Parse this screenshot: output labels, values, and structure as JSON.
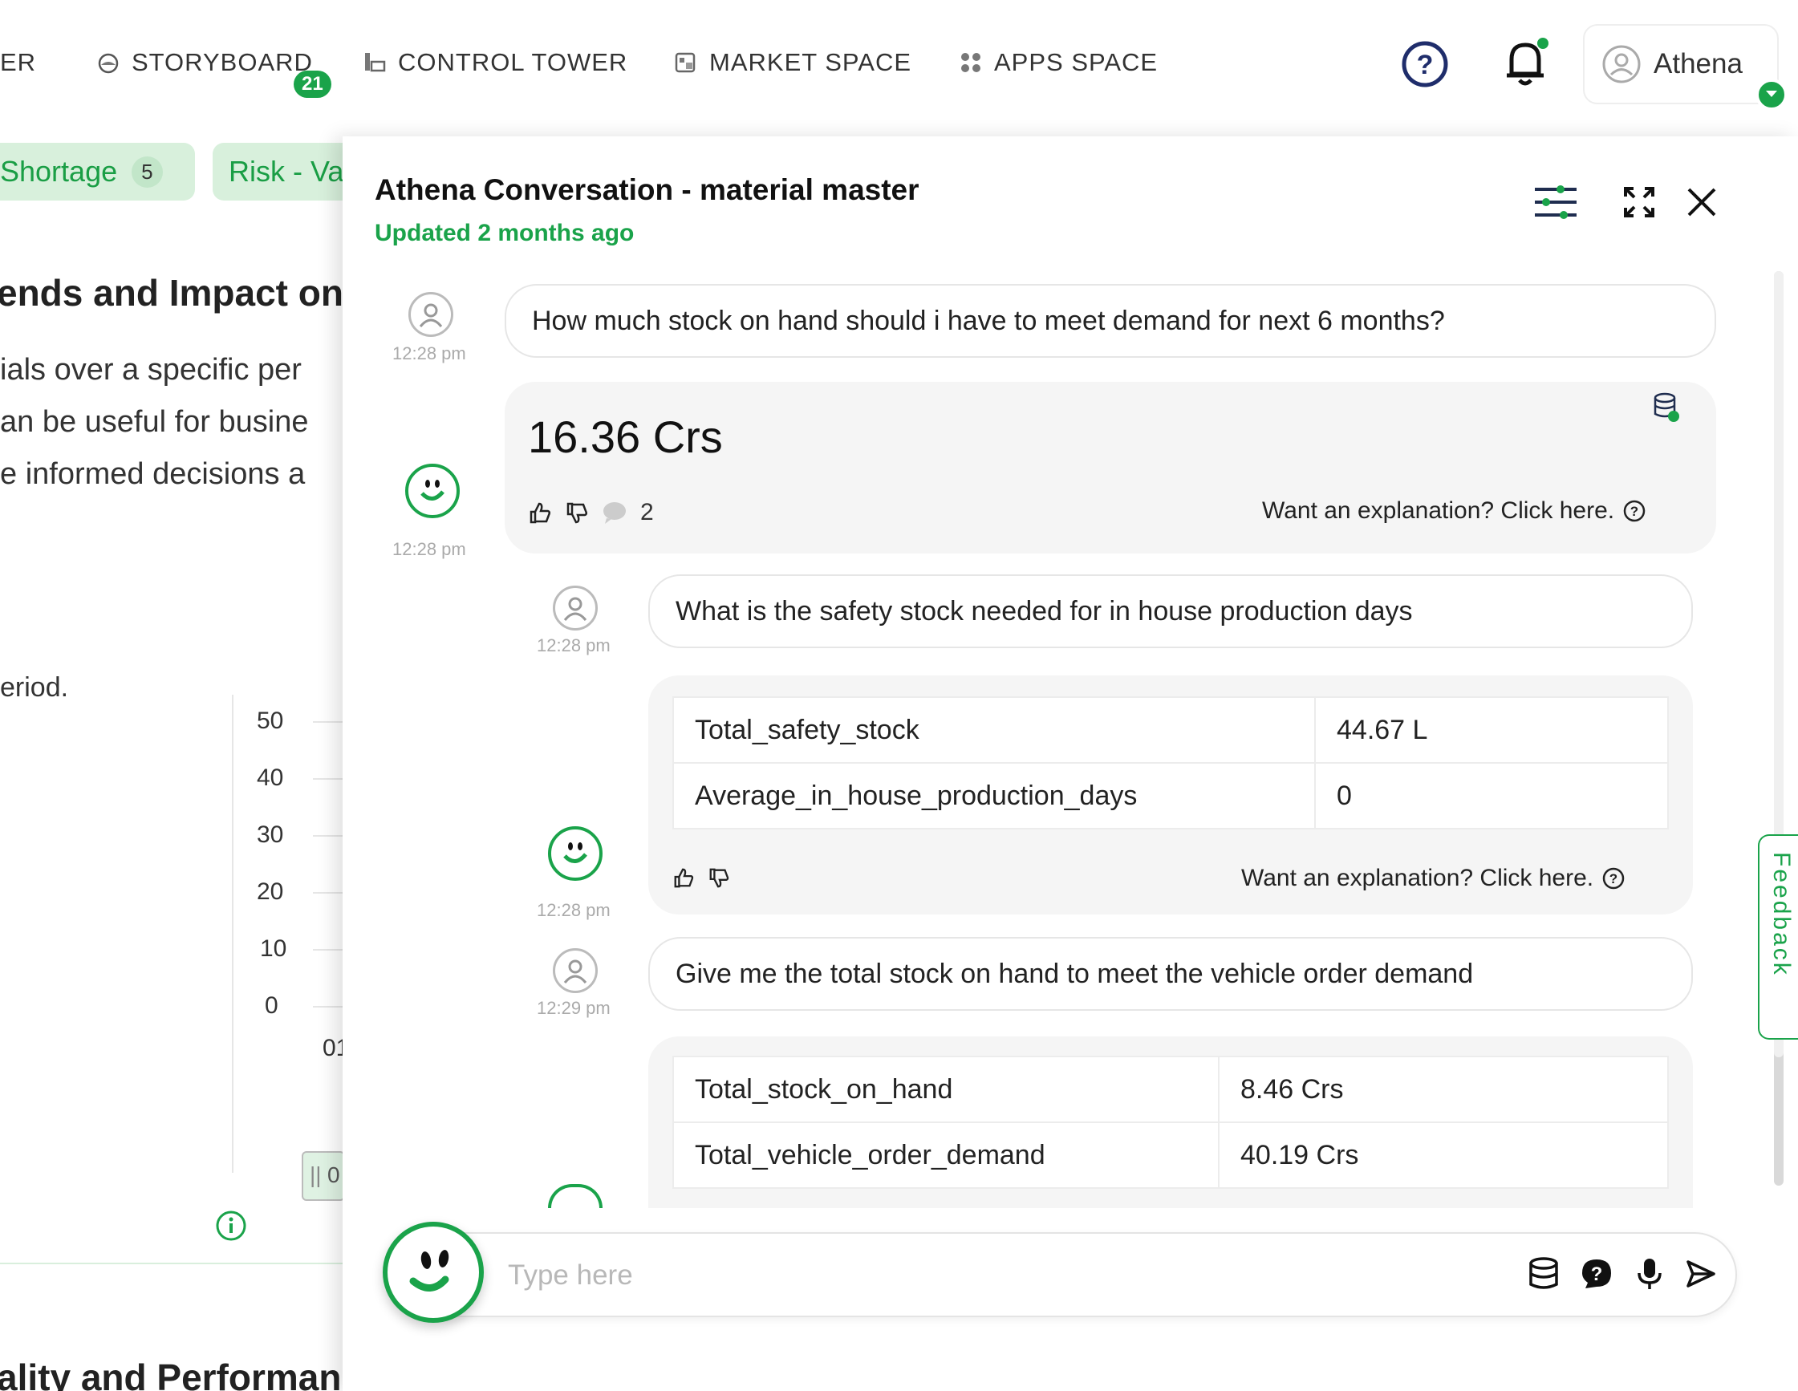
{
  "nav": {
    "items": [
      {
        "label": "ER"
      },
      {
        "label": "STORYBOARD",
        "badge": "21"
      },
      {
        "label": "CONTROL TOWER"
      },
      {
        "label": "MARKET SPACE"
      },
      {
        "label": "APPS SPACE"
      }
    ],
    "user_name": "Athena"
  },
  "dashboard": {
    "chips": [
      {
        "label": "Shortage",
        "count": "5"
      },
      {
        "label": "Risk - Va"
      }
    ],
    "heading": "ends and Impact on",
    "lines": [
      "ials over a specific per",
      "an be useful for busine",
      "e informed decisions a"
    ],
    "period": "eriod.",
    "y_ticks": [
      "50",
      "40",
      "30",
      "20",
      "10",
      "0"
    ],
    "x_tick": "01",
    "slider_label": "0",
    "section_heading": "ality and Performan"
  },
  "chat": {
    "title": "Athena Conversation - material master",
    "updated": "Updated 2 months ago",
    "messages": [
      {
        "question": "How much stock on hand should i have to meet demand for next 6 months?",
        "q_time": "12:28 pm",
        "answer_value": "16.36 Crs",
        "a_time": "12:28 pm",
        "comment_count": "2",
        "explain": "Want an explanation? Click here."
      },
      {
        "question": "What is the safety stock needed for in house production days",
        "q_time": "12:28 pm",
        "a_time": "12:28 pm",
        "rows": [
          {
            "key": "Total_safety_stock",
            "value": "44.67 L"
          },
          {
            "key": "Average_in_house_production_days",
            "value": "0"
          }
        ],
        "explain": "Want an explanation? Click here."
      },
      {
        "question": "Give me the total stock on hand to meet the vehicle order demand",
        "q_time": "12:29 pm",
        "rows": [
          {
            "key": "Total_stock_on_hand",
            "value": "8.46 Crs"
          },
          {
            "key": "Total_vehicle_order_demand",
            "value": "40.19 Crs"
          }
        ]
      }
    ],
    "input_placeholder": "Type here",
    "feedback_label": "Feedback"
  },
  "colors": {
    "accent": "#1aa34a",
    "chip_bg": "#d8f0dc"
  }
}
